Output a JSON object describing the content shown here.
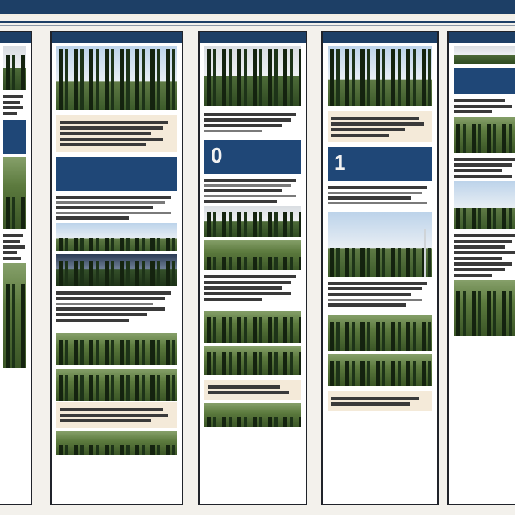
{
  "banner": {
    "title": "",
    "side": ""
  },
  "columns": [
    {
      "id": "col-0",
      "blue_number": ""
    },
    {
      "id": "col-1",
      "blue_number": ""
    },
    {
      "id": "col-2",
      "blue_number": "0"
    },
    {
      "id": "col-3",
      "blue_number": "1"
    },
    {
      "id": "col-4",
      "blue_number": ""
    }
  ],
  "colors": {
    "banner": "#1d3f66",
    "card_blue": "#1f4777",
    "tan": "#f4ead9",
    "frame": "#20232a"
  }
}
